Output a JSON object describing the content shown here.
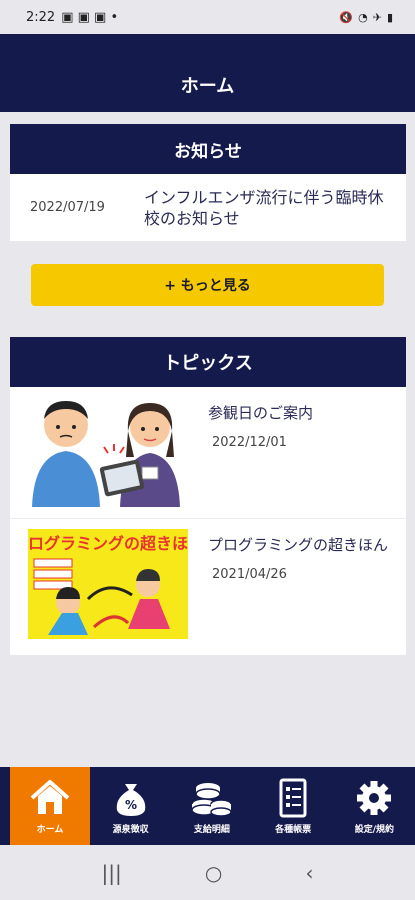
{
  "status_bar": {
    "time": "2:22"
  },
  "header": {
    "title": "ホーム"
  },
  "news": {
    "heading": "お知らせ",
    "items": [
      {
        "date": "2022/07/19",
        "title": "インフルエンザ流行に伴う臨時休校のお知らせ"
      }
    ],
    "more_label": "+ もっと見る"
  },
  "topics": {
    "heading": "トピックス",
    "items": [
      {
        "title": "参観日のご案内",
        "date": "2022/12/01"
      },
      {
        "title": "プログラミングの超きほん",
        "date": "2021/04/26",
        "thumb_text": "プログラミングの超きほん"
      }
    ]
  },
  "bottom_nav": {
    "items": [
      {
        "label": "ホーム",
        "icon": "home-icon",
        "active": true
      },
      {
        "label": "源泉徴収",
        "icon": "money-bag-icon"
      },
      {
        "label": "支給明細",
        "icon": "coins-icon"
      },
      {
        "label": "各種帳票",
        "icon": "document-list-icon"
      },
      {
        "label": "設定/規約",
        "icon": "gear-icon"
      }
    ]
  },
  "colors": {
    "navy": "#151a4d",
    "accent_yellow": "#f5c800",
    "active_orange": "#f07a00"
  }
}
